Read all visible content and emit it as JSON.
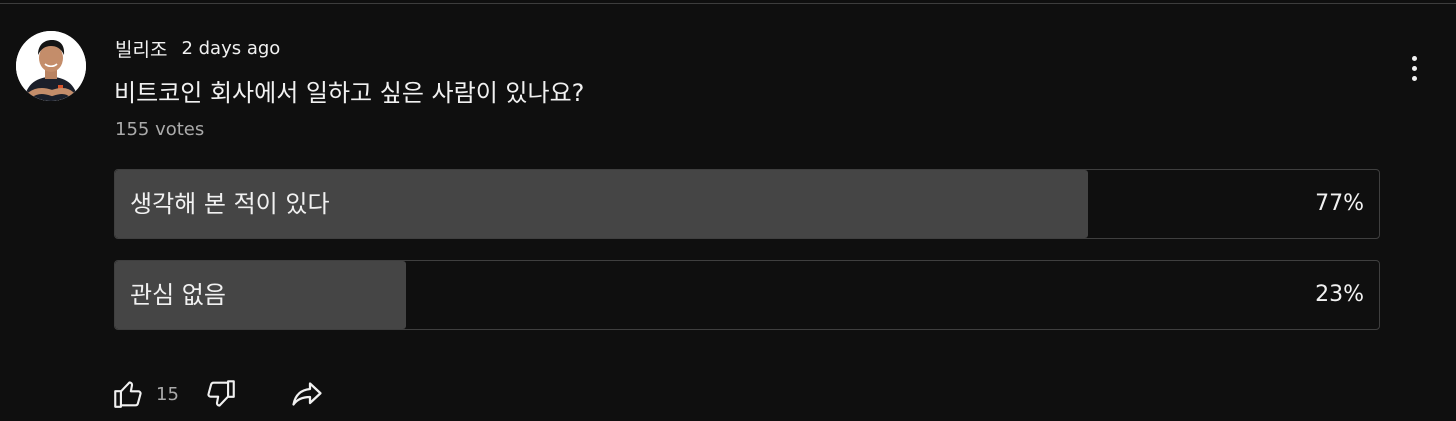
{
  "post": {
    "author": "빌리조",
    "timestamp": "2 days ago",
    "question": "비트코인 회사에서 일하고 싶은 사람이 있나요?",
    "votes": "155 votes",
    "avatar_icon": "person-avatar"
  },
  "poll": {
    "options": [
      {
        "label": "생각해 본 적이 있다",
        "percent_label": "77%",
        "percent": 77
      },
      {
        "label": "관심 없음",
        "percent_label": "23%",
        "percent": 23
      }
    ]
  },
  "actions": {
    "like_count": "15",
    "like_icon": "thumbs-up-icon",
    "dislike_icon": "thumbs-down-icon",
    "share_icon": "share-icon",
    "menu_icon": "more-vertical-icon"
  },
  "colors": {
    "background": "#0f0f0f",
    "bar_fill": "#454545",
    "bar_border": "#3f3f3f",
    "text_primary": "#f1f1f1",
    "text_secondary": "#aaaaaa"
  }
}
